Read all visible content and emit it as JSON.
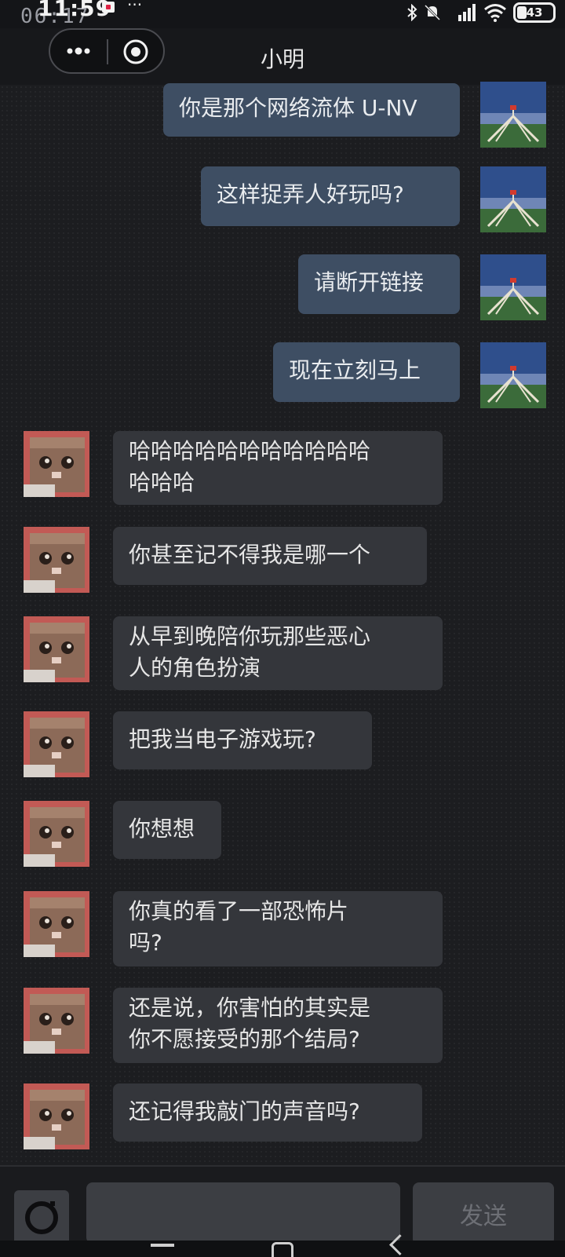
{
  "status_bar": {
    "time": "11:59",
    "game_clock": "06:17",
    "more": "···",
    "battery": "43"
  },
  "header": {
    "title": "小明",
    "more_icon": "more-dots-icon",
    "close_icon": "target-close-icon"
  },
  "messages": [
    {
      "side": "out",
      "text": "你是那个网络流体 U-NV",
      "avatar": "railway-bridge-avatar"
    },
    {
      "side": "out",
      "text": "这样捉弄人好玩吗?",
      "avatar": "railway-bridge-avatar"
    },
    {
      "side": "out",
      "text": "请断开链接",
      "avatar": "railway-bridge-avatar"
    },
    {
      "side": "out",
      "text": "现在立刻马上",
      "avatar": "railway-bridge-avatar"
    },
    {
      "side": "in",
      "text": "哈哈哈哈哈哈哈哈哈哈哈\n哈哈哈",
      "avatar": "cat-box-avatar"
    },
    {
      "side": "in",
      "text": "你甚至记不得我是哪一个",
      "avatar": "cat-box-avatar"
    },
    {
      "side": "in",
      "text": "从早到晚陪你玩那些恶心\n人的角色扮演",
      "avatar": "cat-box-avatar"
    },
    {
      "side": "in",
      "text": "把我当电子游戏玩?",
      "avatar": "cat-box-avatar"
    },
    {
      "side": "in",
      "text": "你想想",
      "avatar": "cat-box-avatar"
    },
    {
      "side": "in",
      "text": "你真的看了一部恐怖片\n吗?",
      "avatar": "cat-box-avatar"
    },
    {
      "side": "in",
      "text": "还是说，你害怕的其实是\n你不愿接受的那个结局?",
      "avatar": "cat-box-avatar"
    },
    {
      "side": "in",
      "text": "还记得我敲门的声音吗?",
      "avatar": "cat-box-avatar"
    }
  ],
  "input_bar": {
    "camera_icon": "camera-icon",
    "input_value": "",
    "input_placeholder": "",
    "send_label": "发送"
  },
  "colors": {
    "outgoing_bubble": "#3e4e63",
    "incoming_bubble": "#34363b",
    "background": "#1c1d20"
  }
}
